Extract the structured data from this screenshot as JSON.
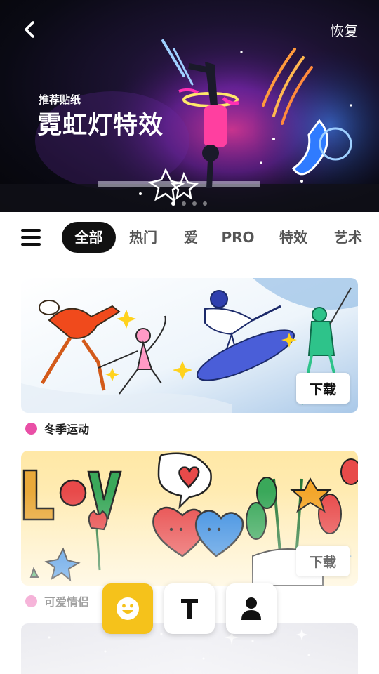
{
  "header": {
    "restore_label": "恢复",
    "back_icon": "chevron-left-icon"
  },
  "banner": {
    "kicker": "推荐贴纸",
    "title": "霓虹灯特效",
    "page_count": 4,
    "active_page": 1
  },
  "tabs": [
    {
      "label": "全部",
      "active": true
    },
    {
      "label": "热门",
      "active": false
    },
    {
      "label": "爱",
      "active": false
    },
    {
      "label": "PRO",
      "active": false
    },
    {
      "label": "特效",
      "active": false
    },
    {
      "label": "艺术",
      "active": false
    }
  ],
  "packs": [
    {
      "name": "冬季运动",
      "download_label": "下载",
      "icon_color": "#e94fa6"
    },
    {
      "name": "可爱情侣",
      "download_label": "下载",
      "icon_color": "#e94fa6"
    }
  ],
  "dock": [
    {
      "icon": "smiley-icon",
      "active": true
    },
    {
      "icon": "text-icon",
      "active": false
    },
    {
      "icon": "person-icon",
      "active": false
    }
  ],
  "colors": {
    "accent": "#f5c21b",
    "active_tab_bg": "#111111",
    "banner_neon_pink": "#ff2fb4",
    "banner_neon_blue": "#3b7bff"
  }
}
